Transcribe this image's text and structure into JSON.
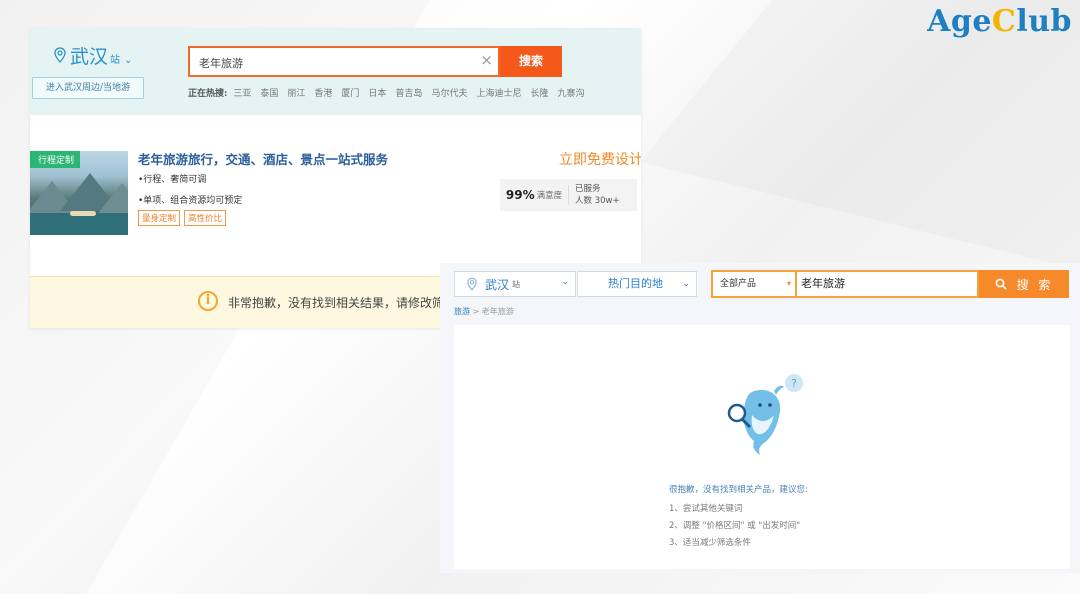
{
  "logo": {
    "part1": "Age",
    "part2": "C",
    "part3": "lub"
  },
  "panel1": {
    "city": {
      "name": "武汉",
      "suffix": "站",
      "chevron": "⌄"
    },
    "nearby_button": "进入武汉周边/当地游",
    "search": {
      "value": "老年旅游",
      "clear": "×",
      "button": "搜索"
    },
    "hot_label": "正在热搜:",
    "hot_tags": [
      "三亚",
      "泰国",
      "丽江",
      "香港",
      "厦门",
      "日本",
      "普吉岛",
      "马尔代夫",
      "上海迪士尼",
      "长隆",
      "九寨沟"
    ],
    "card": {
      "image_tag": "行程定制",
      "title": "老年旅游旅行，交通、酒店、景点一站式服务",
      "bullet1": "•行程、奢简可调",
      "bullet2": "•单项、组合资源均可预定",
      "tags": [
        "量身定制",
        "高性价比"
      ],
      "design_cta": "立即免费设计›",
      "satisfaction_value": "99%",
      "satisfaction_label": "满意度",
      "served_label": "已服务",
      "served_value": "人数 30w+"
    },
    "notice": "非常抱歉，没有找到相关结果，请修改筛选条"
  },
  "panel2": {
    "city": {
      "name": "武汉",
      "suffix": "站",
      "chevron": "⌄"
    },
    "destination": {
      "label": "热门目的地",
      "chevron": "⌄"
    },
    "search": {
      "category": "全部产品",
      "category_arrow": "▾",
      "value": "老年旅游",
      "button": "搜 索"
    },
    "breadcrumb": {
      "root": "旅游",
      "sep": ">",
      "current": "老年旅游"
    },
    "empty": {
      "message": "很抱歉，没有找到相关产品，建议您:",
      "suggestions": [
        "1、尝试其他关键词",
        "2、调整 \"价格区间\" 或 \"出发时间\"",
        "3、适当减少筛选条件"
      ]
    }
  },
  "colors": {
    "brand_blue": "#1e7fc2",
    "orange": "#f4581a",
    "accent_orange": "#f6892a",
    "green_tag": "#2bb673"
  },
  "icons": [
    "location-pin-icon",
    "chevron-down-icon",
    "clear-icon",
    "warning-icon",
    "search-icon",
    "dolphin-illustration"
  ]
}
